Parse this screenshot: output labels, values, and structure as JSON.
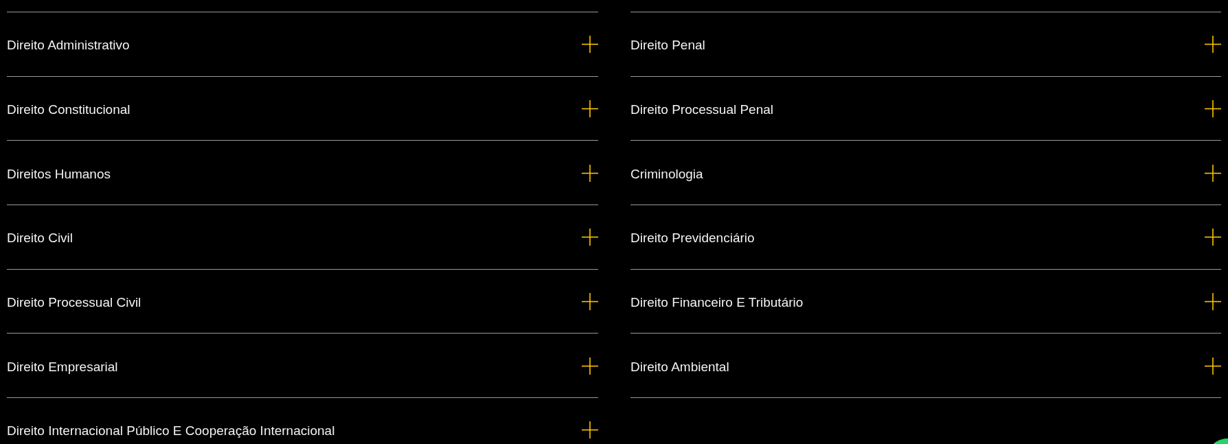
{
  "columns": [
    {
      "items": [
        {
          "label": "Direito Administrativo",
          "expanded": false
        },
        {
          "label": "Direito Constitucional",
          "expanded": false
        },
        {
          "label": "Direitos Humanos",
          "expanded": false
        },
        {
          "label": "Direito Civil",
          "expanded": false
        },
        {
          "label": "Direito Processual Civil",
          "expanded": false
        },
        {
          "label": "Direito Empresarial",
          "expanded": false
        },
        {
          "label": "Direito Internacional Público E Cooperação Internacional",
          "expanded": false
        }
      ]
    },
    {
      "items": [
        {
          "label": "Direito Penal",
          "expanded": false
        },
        {
          "label": "Direito Processual Penal",
          "expanded": false
        },
        {
          "label": "Criminologia",
          "expanded": false
        },
        {
          "label": "Direito Previdenciário",
          "expanded": false
        },
        {
          "label": "Direito Financeiro E Tributário",
          "expanded": false
        },
        {
          "label": "Direito Ambiental",
          "expanded": false
        }
      ]
    }
  ]
}
